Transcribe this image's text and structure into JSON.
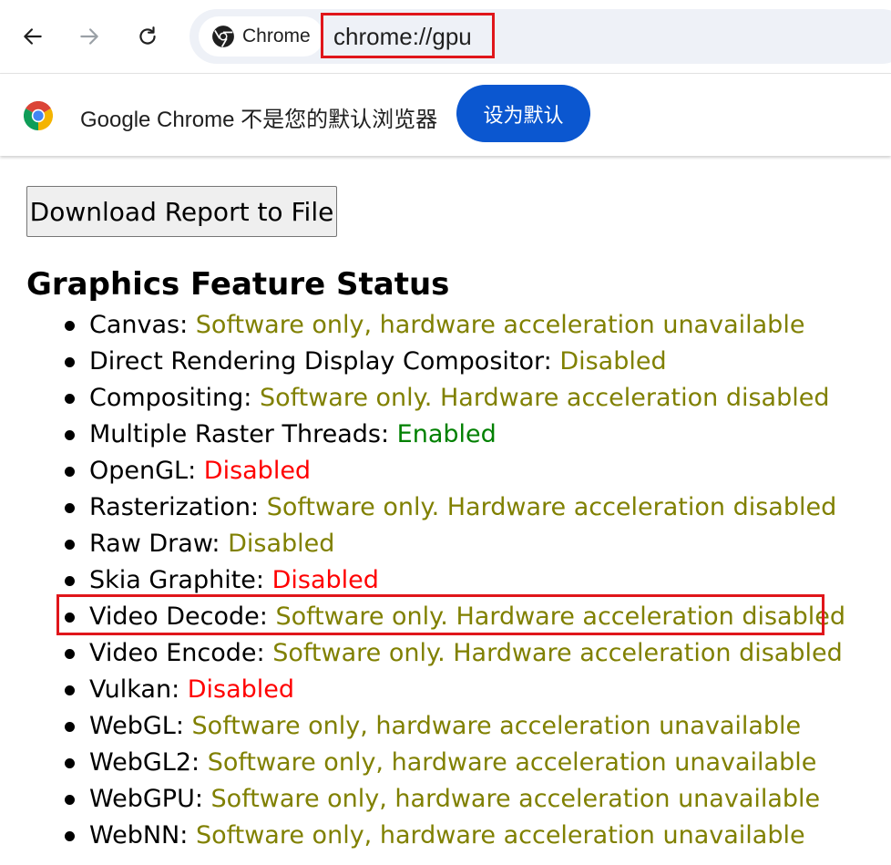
{
  "toolbar": {
    "back_icon": "arrow-left-icon",
    "forward_icon": "arrow-right-icon",
    "reload_icon": "reload-icon",
    "chip_label": "Chrome",
    "url": "chrome://gpu"
  },
  "infobar": {
    "message": "Google Chrome 不是您的默认浏览器",
    "button_label": "设为默认"
  },
  "content": {
    "download_label": "Download Report to File",
    "section_title": "Graphics Feature Status",
    "features": [
      {
        "name": "Canvas:",
        "status": "Software only, hardware acceleration unavailable"
      },
      {
        "name": "Direct Rendering Display Compositor:",
        "status": "Disabled"
      },
      {
        "name": "Compositing:",
        "status": "Software only. Hardware acceleration disabled"
      },
      {
        "name": "Multiple Raster Threads:",
        "status": "Enabled"
      },
      {
        "name": "OpenGL:",
        "status": "Disabled"
      },
      {
        "name": "Rasterization:",
        "status": "Software only. Hardware acceleration disabled"
      },
      {
        "name": "Raw Draw:",
        "status": "Disabled"
      },
      {
        "name": "Skia Graphite:",
        "status": "Disabled"
      },
      {
        "name": "Video Decode:",
        "status": "Software only. Hardware acceleration disabled"
      },
      {
        "name": "Video Encode:",
        "status": "Software only. Hardware acceleration disabled"
      },
      {
        "name": "Vulkan:",
        "status": "Disabled"
      },
      {
        "name": "WebGL:",
        "status": "Software only, hardware acceleration unavailable"
      },
      {
        "name": "WebGL2:",
        "status": "Software only, hardware acceleration unavailable"
      },
      {
        "name": "WebGPU:",
        "status": "Software only, hardware acceleration unavailable"
      },
      {
        "name": "WebNN:",
        "status": "Software only, hardware acceleration unavailable"
      }
    ]
  },
  "colors": {
    "software_only": "#808000",
    "disabled_red": "#ff0000",
    "enabled_green": "#008000",
    "accent_blue": "#0b57d0",
    "highlight_red": "#e0161b"
  }
}
